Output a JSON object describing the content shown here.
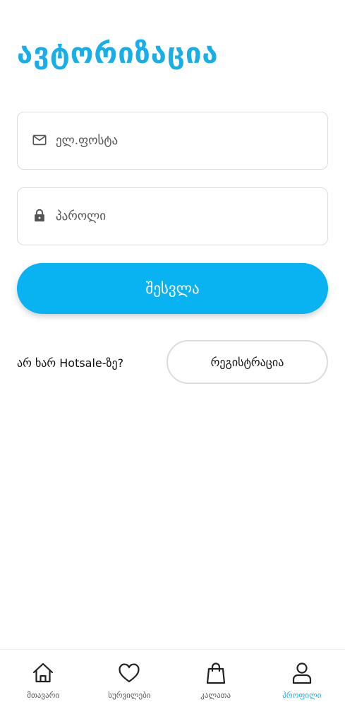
{
  "header": {
    "title": "ავტორიზაცია"
  },
  "form": {
    "email_placeholder": "ელ.ფოსტა",
    "password_placeholder": "პაროლი",
    "login_label": "შესვლა"
  },
  "signup": {
    "prompt": "არ ხარ Hotsale-ზე?",
    "register_label": "რეგისტრაცია"
  },
  "nav": {
    "items": [
      {
        "label": "მთავარი",
        "icon": "home-icon"
      },
      {
        "label": "სურვილები",
        "icon": "heart-icon"
      },
      {
        "label": "კალათა",
        "icon": "shopping-bag-icon"
      },
      {
        "label": "პროფილი",
        "icon": "user-icon"
      }
    ],
    "active_index": 3
  },
  "colors": {
    "accent": "#17aee9",
    "button": "#09b2f0",
    "border": "#dcdcdc"
  }
}
